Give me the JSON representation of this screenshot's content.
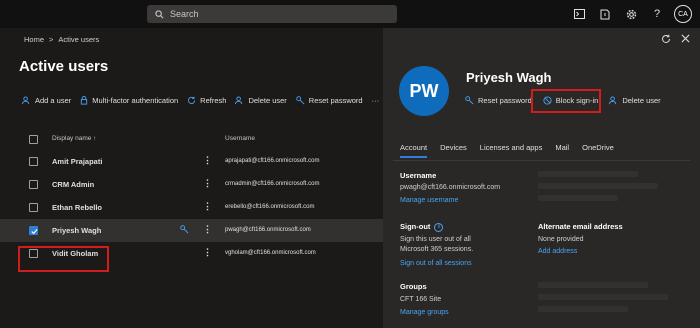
{
  "topbar": {
    "search_placeholder": "Search",
    "avatar_initials": "CA"
  },
  "breadcrumb": {
    "home": "Home",
    "separator": ">",
    "current": "Active users"
  },
  "page_title": "Active users",
  "commands": {
    "add_user": "Add a user",
    "mfa": "Multi-factor authentication",
    "refresh": "Refresh",
    "delete_user": "Delete user",
    "reset_password": "Reset password",
    "more": "···"
  },
  "grid": {
    "col_display_name": "Display name ↑",
    "col_username": "Username",
    "rows": [
      {
        "name": "Amit Prajapati",
        "username": "aprajapati@cft166.onmicrosoft.com",
        "selected": false
      },
      {
        "name": "CRM Admin",
        "username": "crmadmin@cft166.onmicrosoft.com",
        "selected": false
      },
      {
        "name": "Ethan Rebello",
        "username": "erebello@cft166.onmicrosoft.com",
        "selected": false
      },
      {
        "name": "Priyesh Wagh",
        "username": "pwagh@cft166.onmicrosoft.com",
        "selected": true
      },
      {
        "name": "Vidit Gholam",
        "username": "vgholam@cft166.onmicrosoft.com",
        "selected": false
      }
    ]
  },
  "panel": {
    "initials": "PW",
    "name": "Priyesh Wagh",
    "actions": {
      "reset_password": "Reset password",
      "block_signin": "Block sign-in",
      "delete_user": "Delete user"
    },
    "tabs": [
      "Account",
      "Devices",
      "Licenses and apps",
      "Mail",
      "OneDrive"
    ],
    "username_label": "Username",
    "username_value": "pwagh@cft166.onmicrosoft.com",
    "manage_username": "Manage username",
    "signout_label": "Sign-out",
    "signout_text_1": "Sign this user out of all",
    "signout_text_2": "Microsoft 365 sessions.",
    "signout_link": "Sign out of all sessions",
    "alt_email_label": "Alternate email address",
    "alt_email_value": "None provided",
    "add_address": "Add address",
    "groups_label": "Groups",
    "groups_value": "CFT 166 Site",
    "manage_groups": "Manage groups"
  },
  "colors": {
    "accent": "#2f7fd6",
    "highlight_box": "#d21d1d",
    "avatar_bg": "#0f6cbd",
    "link": "#4aa3f0"
  }
}
